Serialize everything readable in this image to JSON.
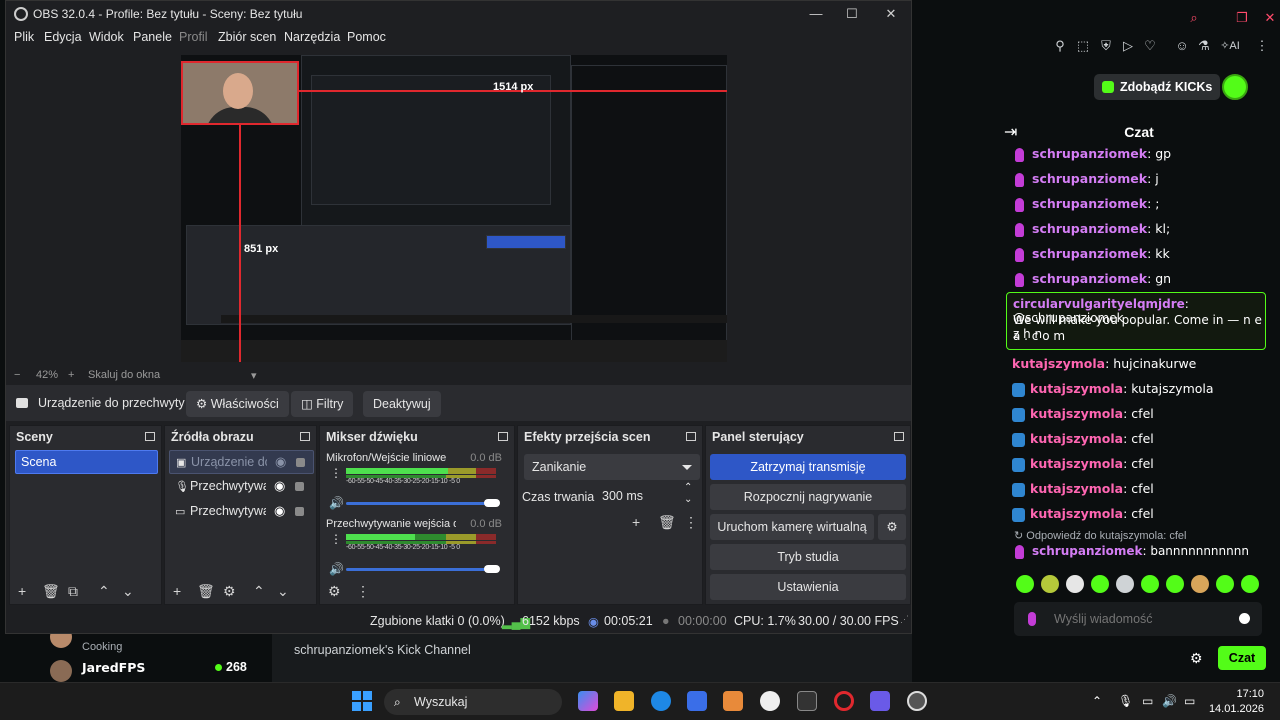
{
  "kick": {
    "get_kicks": "Zdobądź KICKs",
    "chat_title": "Czat",
    "chat_messages": [
      {
        "user": "schrupanziomek",
        "text": ": gp",
        "badge": "mic"
      },
      {
        "user": "schrupanziomek",
        "text": ": j",
        "badge": "mic"
      },
      {
        "user": "schrupanziomek",
        "text": ": ;",
        "badge": "mic"
      },
      {
        "user": "schrupanziomek",
        "text": ": kl;",
        "badge": "mic"
      },
      {
        "user": "schrupanziomek",
        "text": ": kk",
        "badge": "mic"
      },
      {
        "user": "schrupanziomek",
        "text": ": gn",
        "badge": "mic"
      }
    ],
    "highlight": {
      "user": "circularvulgarityelqmjdre",
      "line1_rest": ": @schrupanziomek",
      "line2": "We will make you popular. Come in — n e z h n",
      "line3": "a . c o m"
    },
    "messages2": [
      {
        "user": "kutajszymola",
        "text": ": hujcinakurwe",
        "badge": "none"
      },
      {
        "user": "kutajszymola",
        "text": ": kutajszymola",
        "badge": "sword"
      },
      {
        "user": "kutajszymola",
        "text": ": cfel",
        "badge": "sword"
      },
      {
        "user": "kutajszymola",
        "text": ": cfel",
        "badge": "sword"
      },
      {
        "user": "kutajszymola",
        "text": ": cfel",
        "badge": "sword"
      },
      {
        "user": "kutajszymola",
        "text": ": cfel",
        "badge": "sword"
      },
      {
        "user": "kutajszymola",
        "text": ": cfel",
        "badge": "sword"
      }
    ],
    "reply_note": "↻ Odpowiedź do kutajszymola: cfel",
    "reply_msg": {
      "user": "schrupanziomek",
      "text": ": bannnnnnnnnnn"
    },
    "chat_placeholder": "Wyślij wiadomość",
    "send_label": "Czat",
    "channel_title": "schrupanziomek's Kick Channel",
    "left_items": [
      {
        "name": "JaredFPS",
        "category": "Cooking",
        "viewers": "268"
      }
    ],
    "left_partial": {
      "category": "Cooking"
    }
  },
  "obs": {
    "title": "OBS 32.0.4 - Profile: Bez tytułu - Sceny: Bez tytułu",
    "menu": [
      "Plik",
      "Edycja",
      "Widok",
      "Panele",
      "Profil",
      "Zbiór scen",
      "Narzędzia",
      "Pomoc"
    ],
    "preview": {
      "width_label": "1514 px",
      "height_label": "851 px"
    },
    "zoom": {
      "percent": "42%",
      "minus": "−",
      "plus": "+",
      "fit": "Skaluj do okna"
    },
    "source_bar": {
      "selected": "Urządzenie do przechwyty",
      "properties": "Właściwości",
      "filters": "Filtry",
      "deactivate": "Deaktywuj"
    },
    "scenes": {
      "title": "Sceny",
      "items": [
        "Scena"
      ]
    },
    "sources": {
      "title": "Źródła obrazu",
      "items": [
        {
          "name": "Urządzenie do przechwytywania",
          "icon": "camera-icon"
        },
        {
          "name": "Przechwytywanie wejścia dźwięku",
          "icon": "mic-icon"
        },
        {
          "name": "Przechwytywanie ekranu",
          "icon": "monitor-icon"
        }
      ],
      "short_names": [
        "Urządzenie do",
        "Przechwytywai",
        "Przechwytywai"
      ]
    },
    "mixer": {
      "title": "Mikser dźwięku",
      "channels": [
        {
          "name": "Mikrofon/Wejście liniowe",
          "db": "0.0 dB",
          "level": 0.68,
          "volume": 1.0
        },
        {
          "name": "Przechwytywanie wejścia dźwięku",
          "db": "0.0 dB",
          "level": 0.46,
          "volume": 1.0
        }
      ],
      "scale": "-60-55-50-45-40-35-30-25-20-15-10 -5  0"
    },
    "transitions": {
      "title": "Efekty przejścia scen",
      "selected": "Zanikanie",
      "duration_label": "Czas trwania",
      "duration_value": "300 ms"
    },
    "controls": {
      "title": "Panel sterujący",
      "stop_stream": "Zatrzymaj transmisję",
      "start_record": "Rozpocznij nagrywanie",
      "virtual_cam": "Uruchom kamerę wirtualną",
      "studio": "Tryb studia",
      "settings": "Ustawienia"
    },
    "status": {
      "dropped": "Zgubione klatki 0 (0.0%)",
      "bitrate": "6152 kbps",
      "stream_time": "00:05:21",
      "rec_time": "00:00:00",
      "cpu": "CPU: 1.7%",
      "fps": "30.00 / 30.00 FPS"
    }
  },
  "taskbar": {
    "search": "Wyszukaj",
    "time": "17:10",
    "date": "14.01.2026"
  },
  "colors": {
    "kick_green": "#53fc18",
    "obs_blue": "#2e57c7",
    "live_red": "#e0282e"
  }
}
